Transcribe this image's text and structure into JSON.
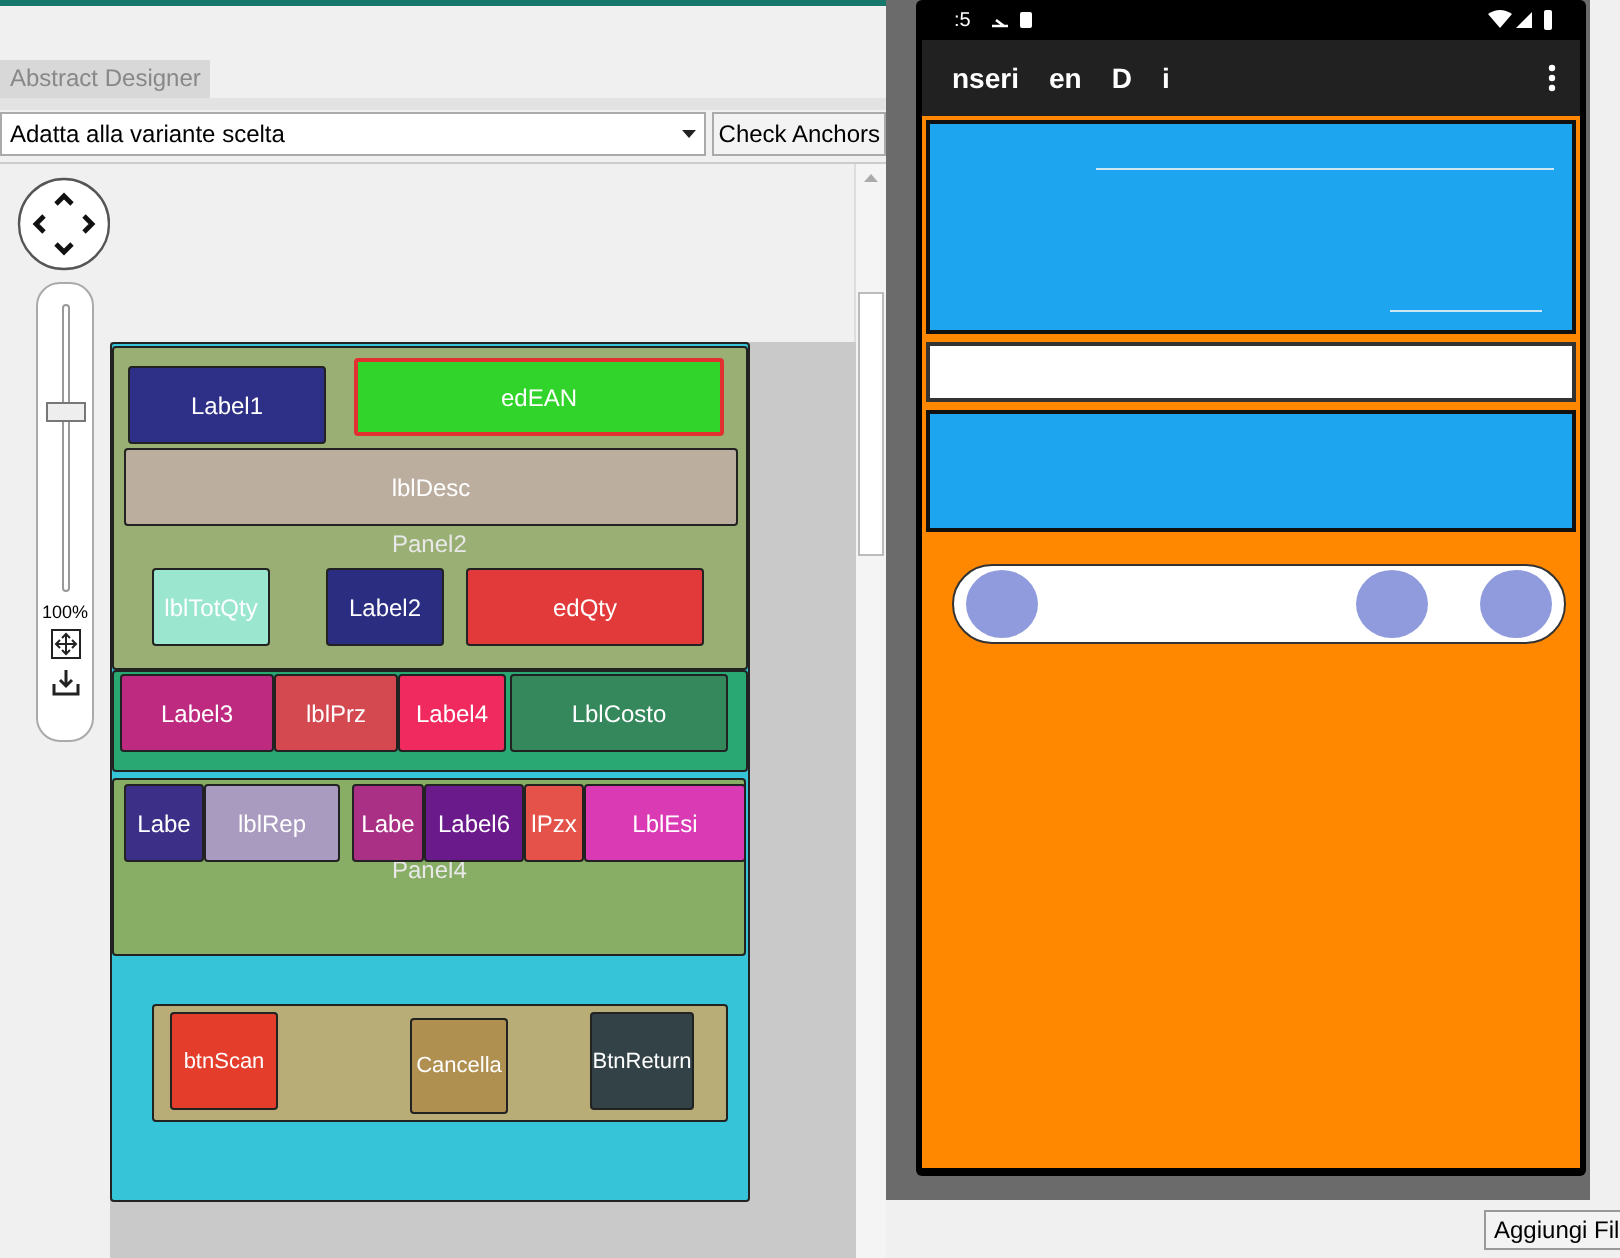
{
  "designer_tab": {
    "label": "Abstract Designer",
    "selected": true
  },
  "variant_dropdown": {
    "value": "Adatta alla variante scelta"
  },
  "check_anchors_button": "Check Anchors",
  "zoom": {
    "level": 0.62,
    "reading": "100%"
  },
  "designer": {
    "panels": [
      {
        "kind": "panel",
        "color": "#36c4d8"
      },
      {
        "kind": "panel",
        "color": "#9aaf74",
        "caption": "Panel2"
      },
      {
        "kind": "panel",
        "color": "#2aa874"
      },
      {
        "kind": "panel",
        "color": "#88ad64",
        "caption": "Panel4"
      },
      {
        "kind": "panel",
        "color": "#b8ad76"
      }
    ],
    "widgets": [
      {
        "kind": "label",
        "text": "Label1",
        "color": "#2e2f86"
      },
      {
        "kind": "edit",
        "text": "edEAN",
        "color": "#31d42a"
      },
      {
        "kind": "label",
        "text": "lblDesc",
        "color": "#bcae9f"
      },
      {
        "kind": "label",
        "text": "lblTotQty",
        "color": "#9ae6cf"
      },
      {
        "kind": "label",
        "text": "Label2",
        "color": "#2a2d80"
      },
      {
        "kind": "label",
        "text": "edQty",
        "color": "#e23a3a"
      },
      {
        "kind": "label",
        "text": "Label3",
        "color": "#bd2a7f"
      },
      {
        "kind": "label",
        "text": "lblPrz",
        "color": "#d4484f"
      },
      {
        "kind": "label",
        "text": "Label4",
        "color": "#f02a5e"
      },
      {
        "kind": "label",
        "text": "LblCosto",
        "color": "#34885c"
      },
      {
        "kind": "label",
        "text": "Labe",
        "color": "#3c2f88"
      },
      {
        "kind": "label",
        "text": "lblRep",
        "color": "#a99bbf"
      },
      {
        "kind": "label",
        "text": "Labe",
        "color": "#a93084"
      },
      {
        "kind": "label",
        "text": "Label6",
        "color": "#6a1a8a"
      },
      {
        "kind": "label",
        "text": "lPzx",
        "color": "#e5524a"
      },
      {
        "kind": "label",
        "text": "LblEsi",
        "color": "#da3bb5"
      },
      {
        "kind": "button",
        "text": "btnScan",
        "color": "#e43d2b"
      },
      {
        "kind": "button",
        "text": "Cancella",
        "color": "#b09050"
      },
      {
        "kind": "button",
        "text": "BtnReturn",
        "color": "#334246"
      }
    ]
  },
  "phone": {
    "status_time": ":5",
    "app_title": [
      "nseri",
      "en",
      "D",
      "i"
    ]
  },
  "add_file_button": "Aggiungi Fil"
}
